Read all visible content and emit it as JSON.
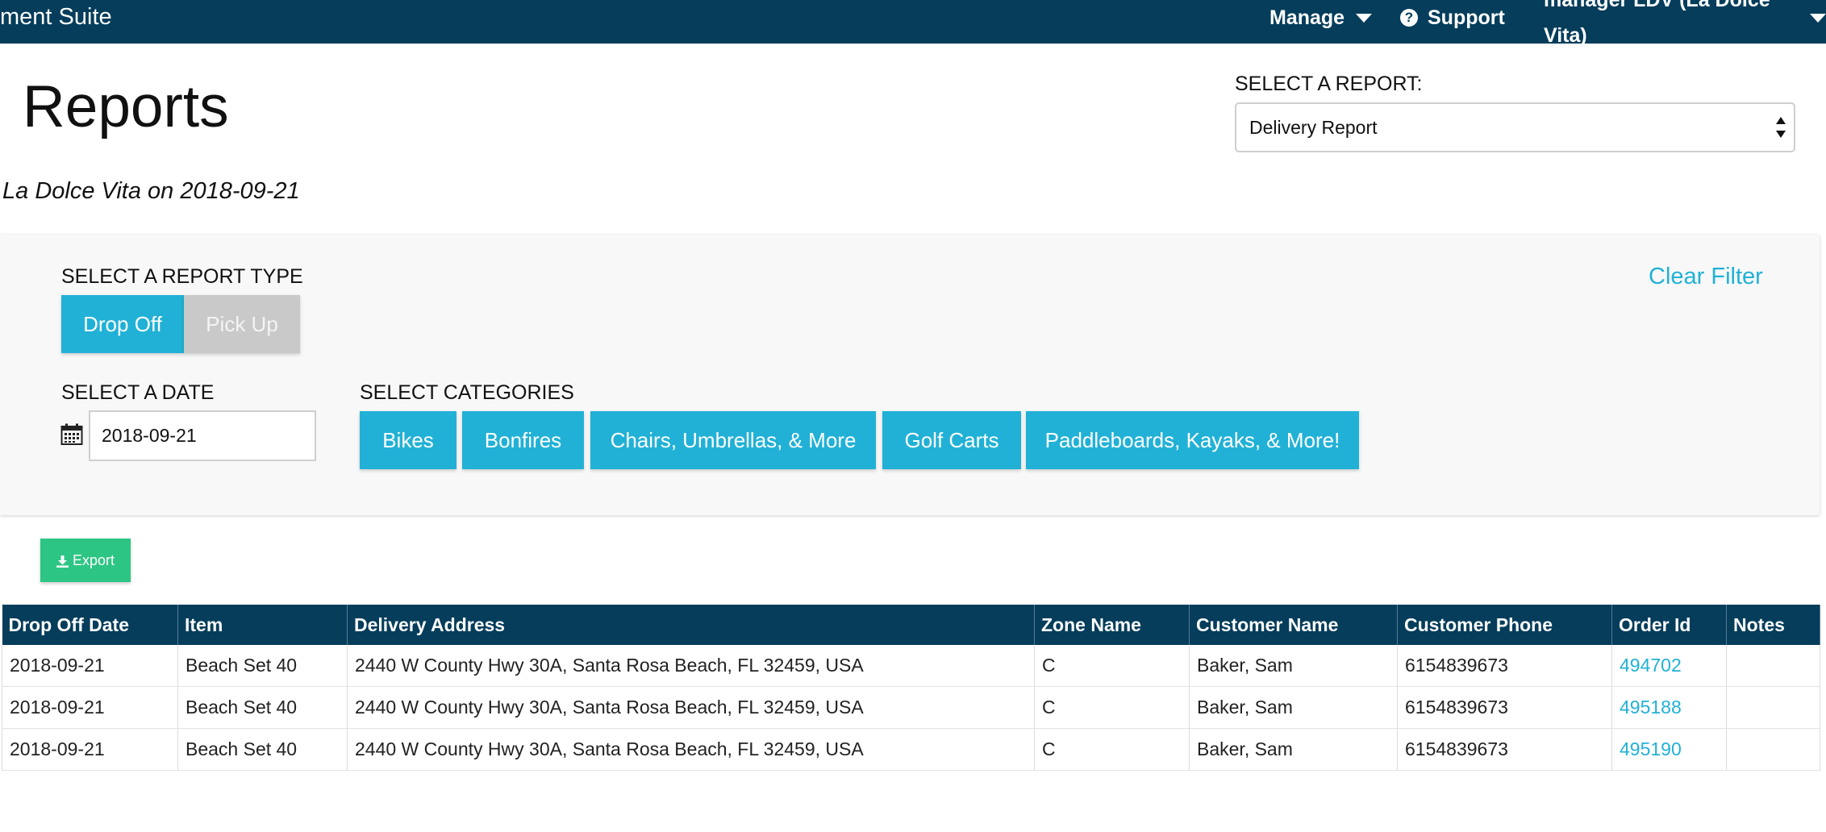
{
  "topbar": {
    "brand": "ment Suite",
    "manage_label": "Manage",
    "support_label": "Support",
    "user_label": "manager LDV (La Dolce Vita)"
  },
  "page": {
    "title": "Reports",
    "select_report_label": "SELECT A REPORT:",
    "selected_report": "Delivery Report",
    "subtitle": "La Dolce Vita on 2018-09-21"
  },
  "filters": {
    "report_type_label": "SELECT A REPORT TYPE",
    "drop_off_label": "Drop Off",
    "pick_up_label": "Pick Up",
    "clear_filter_label": "Clear Filter",
    "date_label": "SELECT A DATE",
    "date_value": "2018-09-21",
    "categories_label": "SELECT CATEGORIES",
    "categories": [
      "Bikes",
      "Bonfires",
      "Chairs, Umbrellas, & More",
      "Golf Carts",
      "Paddleboards, Kayaks, & More!"
    ]
  },
  "export_label": "Export",
  "table": {
    "headers": [
      "Drop Off Date",
      "Item",
      "Delivery Address",
      "Zone Name",
      "Customer Name",
      "Customer Phone",
      "Order Id",
      "Notes"
    ],
    "rows": [
      [
        "2018-09-21",
        "Beach Set 40",
        "2440 W County Hwy 30A, Santa Rosa Beach, FL 32459, USA",
        "C",
        "Baker, Sam",
        "6154839673",
        "494702",
        ""
      ],
      [
        "2018-09-21",
        "Beach Set 40",
        "2440 W County Hwy 30A, Santa Rosa Beach, FL 32459, USA",
        "C",
        "Baker, Sam",
        "6154839673",
        "495188",
        ""
      ],
      [
        "2018-09-21",
        "Beach Set 40",
        "2440 W County Hwy 30A, Santa Rosa Beach, FL 32459, USA",
        "C",
        "Baker, Sam",
        "6154839673",
        "495190",
        ""
      ]
    ]
  },
  "colors": {
    "navbar": "#053d5b",
    "accent": "#21b1d6",
    "export": "#2dc584",
    "inactive": "#c9c9c9"
  }
}
